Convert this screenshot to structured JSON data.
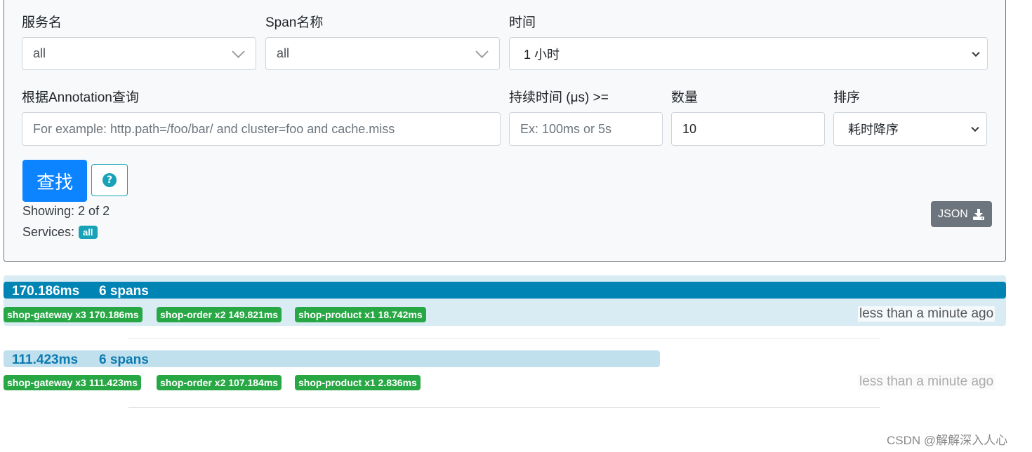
{
  "form": {
    "service_label": "服务名",
    "service_value": "all",
    "span_label": "Span名称",
    "span_value": "all",
    "time_label": "时间",
    "time_value": "1 小时",
    "annotation_label": "根据Annotation查询",
    "annotation_placeholder": "For example: http.path=/foo/bar/ and cluster=foo and cache.miss",
    "duration_label": "持续时间 (μs) >=",
    "duration_placeholder": "Ex: 100ms or 5s",
    "limit_label": "数量",
    "limit_value": "10",
    "sort_label": "排序",
    "sort_value": "耗时降序",
    "search_button": "查找",
    "help_icon": "?",
    "showing_text": "Showing: 2 of 2",
    "services_label": "Services:",
    "services_badge": "all",
    "json_button": "JSON"
  },
  "traces": [
    {
      "duration": "170.186ms",
      "spans": "6 spans",
      "bar_fraction": 1.0,
      "tags": [
        "shop-gateway x3 170.186ms",
        "shop-order x2 149.821ms",
        "shop-product x1 18.742ms"
      ],
      "time_ago": "less than a minute ago"
    },
    {
      "duration": "111.423ms",
      "spans": "6 spans",
      "bar_fraction": 0.6547,
      "tags": [
        "shop-gateway x3 111.423ms",
        "shop-order x2 107.184ms",
        "shop-product x1 2.836ms"
      ],
      "time_ago": "less than a minute ago"
    }
  ],
  "colors": {
    "primary": "#0d84ff",
    "trace_bar_selected": "#0084b4",
    "trace_bar_light": "#c1e0ee",
    "tag_green": "#28a745",
    "info": "#17a2b8"
  },
  "watermark": "CSDN @解解深入人心"
}
